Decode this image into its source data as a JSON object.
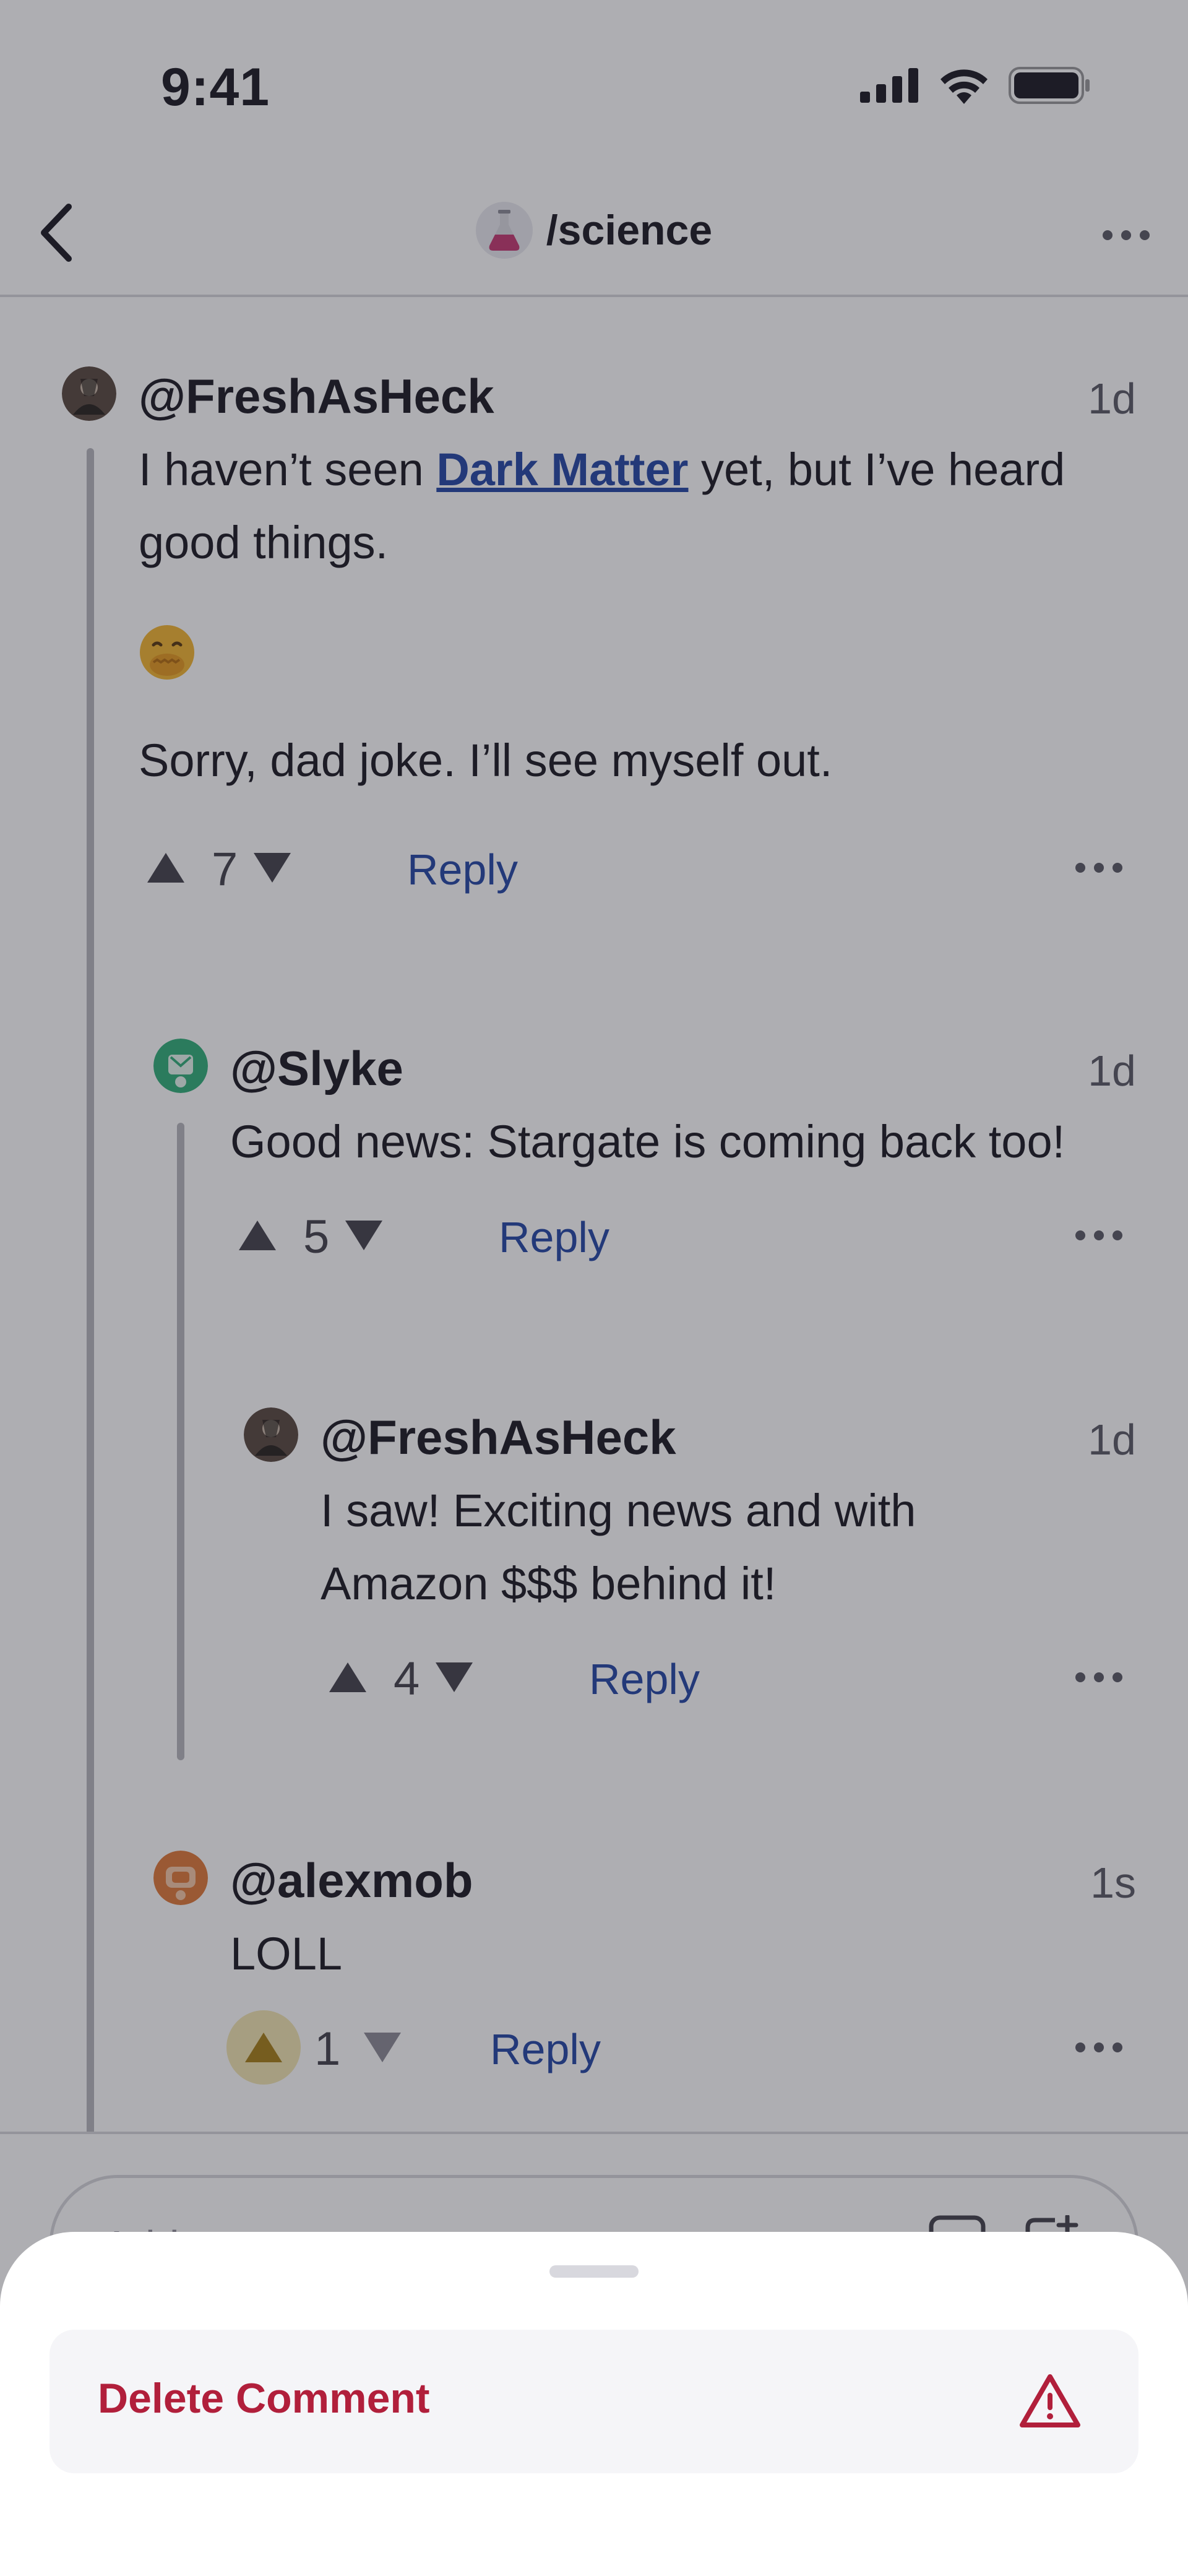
{
  "status_bar": {
    "time": "9:41"
  },
  "nav": {
    "community": "/science"
  },
  "comments": [
    {
      "user": "@FreshAsHeck",
      "time": "1d",
      "text_before": "I haven’t seen ",
      "link": "Dark Matter",
      "text_after": " yet, but I’ve heard good things.",
      "emoji": "🤭",
      "text2": "Sorry, dad joke. I’ll see myself out.",
      "score": "7",
      "reply_label": "Reply"
    },
    {
      "user": "@Slyke",
      "time": "1d",
      "text": "Good news: Stargate is coming back too!",
      "score": "5",
      "reply_label": "Reply"
    },
    {
      "user": "@FreshAsHeck",
      "time": "1d",
      "text_line1": "I saw! Exciting news and with",
      "text_line2": "Amazon $$$ behind it!",
      "score": "4",
      "reply_label": "Reply"
    },
    {
      "user": "@alexmob",
      "time": "1s",
      "text": "LOLL",
      "score": "1",
      "reply_label": "Reply",
      "upvoted": true
    }
  ],
  "composer": {
    "placeholder": "Add a comment"
  },
  "sheet": {
    "action_label": "Delete Comment",
    "action_icon": "warning-icon",
    "danger_color": "#b11f3b"
  },
  "colors": {
    "accent": "#2649a6",
    "danger": "#b11f3b",
    "upvote_active": "#a8801a"
  }
}
